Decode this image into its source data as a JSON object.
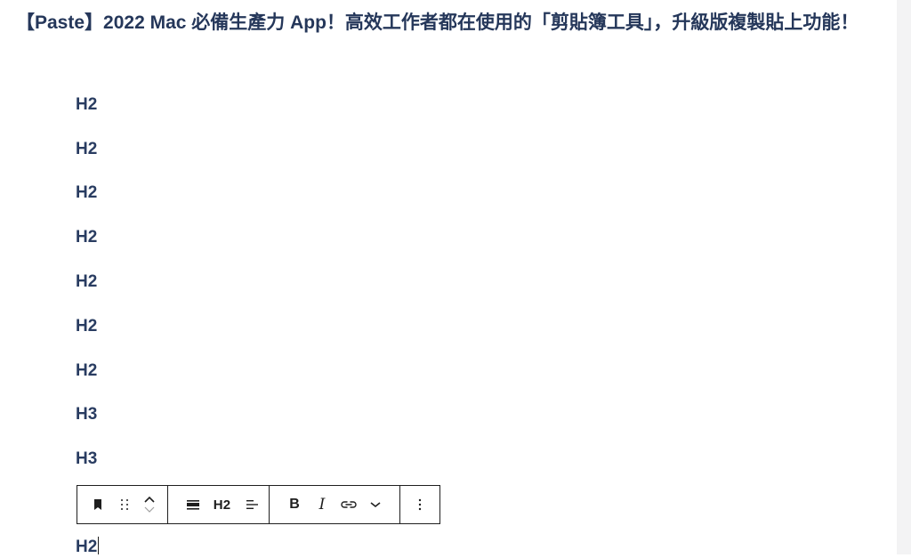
{
  "document": {
    "title": "【Paste】2022 Mac 必備生產力 App！高效工作者都在使用的「剪貼簿工具」，升級版複製貼上功能！"
  },
  "blocks": [
    {
      "label": "H2"
    },
    {
      "label": "H2"
    },
    {
      "label": "H2"
    },
    {
      "label": "H2"
    },
    {
      "label": "H2"
    },
    {
      "label": "H2"
    },
    {
      "label": "H2"
    },
    {
      "label": "H3"
    },
    {
      "label": "H3"
    }
  ],
  "toolbar": {
    "block_type_icon": "bookmark-icon",
    "drag_icon": "drag-handle-icon",
    "move_up_icon": "chevron-up-icon",
    "move_down_icon": "chevron-down-icon",
    "align_icon": "align-center-icon",
    "heading_level_label": "H2",
    "text_align_icon": "text-align-icon",
    "bold_label": "B",
    "italic_label": "I",
    "link_icon": "link-icon",
    "more_formatting_icon": "chevron-down-icon",
    "options_icon": "more-vertical-icon"
  },
  "current_block": {
    "label": "H2"
  },
  "colors": {
    "heading_text": "#293c61",
    "toolbar_border": "#1f1f1f",
    "gutter": "#f3f3f4"
  }
}
